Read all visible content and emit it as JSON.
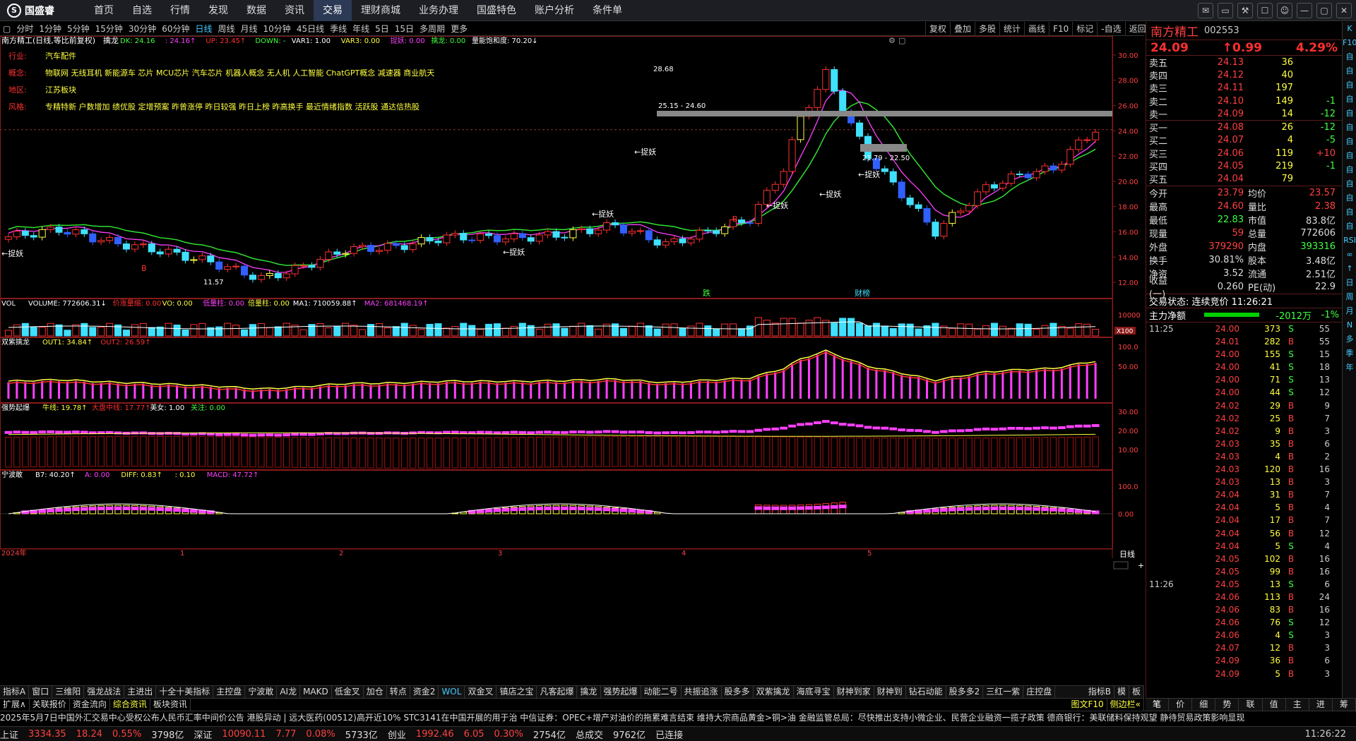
{
  "app": {
    "logo": "国盛睿",
    "logo_icon": "logo-icon"
  },
  "menu": [
    "首页",
    "自选",
    "行情",
    "发现",
    "数据",
    "资讯",
    "交易",
    "理财商城",
    "业务办理",
    "国盛特色",
    "账户分析",
    "条件单"
  ],
  "menu_active": 6,
  "periods": [
    "分时",
    "1分钟",
    "5分钟",
    "15分钟",
    "30分钟",
    "60分钟",
    "日线",
    "周线",
    "月线",
    "10分钟",
    "45日线",
    "季线",
    "年线",
    "5日",
    "15日",
    "多周期",
    "更多"
  ],
  "period_active": 6,
  "tools": [
    "复权",
    "叠加",
    "多股",
    "统计",
    "画线",
    "F10",
    "标记",
    "-自选",
    "返回"
  ],
  "stock": {
    "name": "南方精工",
    "code": "002553",
    "price": "24.09",
    "change": "↑0.99",
    "pct": "4.29%"
  },
  "main_header": {
    "title": "南方精工(日线,等比前复权)",
    "indicator": "擒龙",
    "items": [
      {
        "t": "DK: 24.16",
        "c": "#40ff40"
      },
      {
        "t": ": 24.16↑",
        "c": "#ff40ff"
      },
      {
        "t": "UP: 23.45↑",
        "c": "#ff3030"
      },
      {
        "t": "DOWN: -",
        "c": "#40ff40"
      },
      {
        "t": "VAR1: 1.00",
        "c": "#fff"
      },
      {
        "t": "VAR3: 0.00",
        "c": "#ffff40"
      },
      {
        "t": "捉妖: 0.00",
        "c": "#ff40ff"
      },
      {
        "t": "擒龙: 0.00",
        "c": "#40ff40"
      },
      {
        "t": "量能饱和度: 70.20↓",
        "c": "#fff"
      }
    ]
  },
  "stock_info": [
    {
      "k": "行业:",
      "v": "汽车配件"
    },
    {
      "k": "概念:",
      "v": "物联网 无线耳机 新能源车 芯片 MCU芯片 汽车芯片 机器人概念 无人机 人工智能 ChatGPT概念 减速器 商业航天"
    },
    {
      "k": "地区:",
      "v": "江苏板块"
    },
    {
      "k": "风格:",
      "v": "专精特新 户数增加 绩优股 定增预案 昨曾涨停 昨日较强 昨日上榜 昨高换手 最近情绪指数 活跃股 通达信热股"
    }
  ],
  "price_axis": [
    "30.00",
    "28.00",
    "26.00",
    "24.00",
    "22.00",
    "20.00",
    "18.00",
    "16.00",
    "14.00",
    "12.00"
  ],
  "annotations": {
    "high": "28.68",
    "zone1": "25.15 - 24.60",
    "zone2": "21.79 - 22.50",
    "low": "11.57",
    "label": "捉妖",
    "b_mark": "B",
    "die": "跌",
    "caibao": "财榜"
  },
  "vol_header": {
    "name": "VOL",
    "items": [
      {
        "t": "VOLUME: 772606.31↓",
        "c": "#fff"
      },
      {
        "t": "价涨量缩: 0.00",
        "c": "#ff3030"
      },
      {
        "t": "VO: 0.00",
        "c": "#ffff40"
      },
      {
        "t": "低量柱: 0.00",
        "c": "#ff40ff"
      },
      {
        "t": "倍量柱: 0.00",
        "c": "#ffff40"
      },
      {
        "t": "MA1: 710059.88↑",
        "c": "#fff"
      },
      {
        "t": "MA2: 681468.19↑",
        "c": "#ff40ff"
      }
    ],
    "axis": [
      "10000"
    ],
    "unit": "X100"
  },
  "sub1_header": {
    "name": "双紫擒龙",
    "items": [
      {
        "t": "OUT1: 34.84↑",
        "c": "#ffff40"
      },
      {
        "t": "OUT2: 26.59↑",
        "c": "#ff3030"
      }
    ],
    "axis": [
      "100.0",
      "50.00"
    ]
  },
  "sub2_header": {
    "name": "强势起爆",
    "items": [
      {
        "t": "牛线: 19.78↑",
        "c": "#ffff40"
      },
      {
        "t": "大盘中线: 17.77↑",
        "c": "#ff3030"
      },
      {
        "t": "美女: 1.00",
        "c": "#fff"
      },
      {
        "t": "关注: 0.00",
        "c": "#40ff40"
      }
    ],
    "axis": [
      "30.00",
      "20.00",
      "10.00"
    ]
  },
  "sub3_header": {
    "name": "宁波敢",
    "items": [
      {
        "t": "B7: 40.20↑",
        "c": "#fff"
      },
      {
        "t": "A: 0.00",
        "c": "#ff40ff"
      },
      {
        "t": "DIFF: 0.83↑",
        "c": "#ffff40"
      },
      {
        "t": ": 0.10",
        "c": "#ffff40"
      },
      {
        "t": "MACD: 47.72↑",
        "c": "#ff40ff"
      }
    ],
    "axis": [
      "100.0",
      "0.00"
    ]
  },
  "date_axis": [
    "2024年",
    "1",
    "2",
    "3",
    "4",
    "5"
  ],
  "period_label": "日线",
  "asks": [
    {
      "l": "卖五",
      "p": "24.13",
      "v": "36",
      "d": ""
    },
    {
      "l": "卖四",
      "p": "24.12",
      "v": "40",
      "d": ""
    },
    {
      "l": "卖三",
      "p": "24.11",
      "v": "197",
      "d": ""
    },
    {
      "l": "卖二",
      "p": "24.10",
      "v": "149",
      "d": "-1"
    },
    {
      "l": "卖一",
      "p": "24.09",
      "v": "14",
      "d": "-12"
    }
  ],
  "bids": [
    {
      "l": "买一",
      "p": "24.08",
      "v": "26",
      "d": "-12"
    },
    {
      "l": "买二",
      "p": "24.07",
      "v": "4",
      "d": "-5"
    },
    {
      "l": "买三",
      "p": "24.06",
      "v": "119",
      "d": "+10"
    },
    {
      "l": "买四",
      "p": "24.05",
      "v": "219",
      "d": "-1"
    },
    {
      "l": "买五",
      "p": "24.04",
      "v": "79",
      "d": ""
    }
  ],
  "quote": [
    {
      "a": "今开",
      "b": "23.79",
      "c": "均价",
      "e": "23.57",
      "bc": "#ff4040",
      "ec": "#ff4040"
    },
    {
      "a": "最高",
      "b": "24.60",
      "c": "量比",
      "e": "2.38",
      "bc": "#ff4040",
      "ec": "#ff4040"
    },
    {
      "a": "最低",
      "b": "22.83",
      "c": "市值",
      "e": "83.8亿",
      "bc": "#40ff40",
      "ec": "#ddd"
    },
    {
      "a": "现量",
      "b": "59",
      "c": "总量",
      "e": "772606",
      "bc": "#ff4040",
      "ec": "#ddd"
    },
    {
      "a": "外盘",
      "b": "379290",
      "c": "内盘",
      "e": "393316",
      "bc": "#ff4040",
      "ec": "#40ff40"
    },
    {
      "a": "换手",
      "b": "30.81%",
      "c": "股本",
      "e": "3.48亿",
      "bc": "#ddd",
      "ec": "#ddd"
    },
    {
      "a": "净资",
      "b": "3.52",
      "c": "流通",
      "e": "2.51亿",
      "bc": "#ddd",
      "ec": "#ddd"
    },
    {
      "a": "收益(一)",
      "b": "0.260",
      "c": "PE(动)",
      "e": "22.9",
      "bc": "#ddd",
      "ec": "#ddd"
    }
  ],
  "trade_status": "交易状态: 连续竞价 11:26:21",
  "main_net": {
    "label": "主力净额",
    "value": "-2012万",
    "pct": "-1%"
  },
  "ticks": [
    {
      "t": "11:25",
      "p": "24.00",
      "v": "373",
      "s": "S",
      "n": "55"
    },
    {
      "t": "",
      "p": "24.01",
      "v": "282",
      "s": "B",
      "n": "55"
    },
    {
      "t": "",
      "p": "24.00",
      "v": "155",
      "s": "S",
      "n": "15"
    },
    {
      "t": "",
      "p": "24.00",
      "v": "41",
      "s": "S",
      "n": "18"
    },
    {
      "t": "",
      "p": "24.00",
      "v": "71",
      "s": "S",
      "n": "13"
    },
    {
      "t": "",
      "p": "24.00",
      "v": "44",
      "s": "S",
      "n": "12"
    },
    {
      "t": "",
      "p": "24.02",
      "v": "29",
      "s": "B",
      "n": "9"
    },
    {
      "t": "",
      "p": "24.02",
      "v": "25",
      "s": "B",
      "n": "7"
    },
    {
      "t": "",
      "p": "24.02",
      "v": "9",
      "s": "B",
      "n": "3"
    },
    {
      "t": "",
      "p": "24.03",
      "v": "35",
      "s": "B",
      "n": "6"
    },
    {
      "t": "",
      "p": "24.03",
      "v": "4",
      "s": "B",
      "n": "2"
    },
    {
      "t": "",
      "p": "24.03",
      "v": "120",
      "s": "B",
      "n": "16"
    },
    {
      "t": "",
      "p": "24.03",
      "v": "13",
      "s": "B",
      "n": "3"
    },
    {
      "t": "",
      "p": "24.04",
      "v": "31",
      "s": "B",
      "n": "7"
    },
    {
      "t": "",
      "p": "24.04",
      "v": "5",
      "s": "B",
      "n": "4"
    },
    {
      "t": "",
      "p": "24.04",
      "v": "17",
      "s": "B",
      "n": "7"
    },
    {
      "t": "",
      "p": "24.04",
      "v": "56",
      "s": "B",
      "n": "12"
    },
    {
      "t": "",
      "p": "24.04",
      "v": "5",
      "s": "S",
      "n": "4"
    },
    {
      "t": "",
      "p": "24.05",
      "v": "102",
      "s": "B",
      "n": "16"
    },
    {
      "t": "",
      "p": "24.05",
      "v": "99",
      "s": "B",
      "n": "16"
    },
    {
      "t": "11:26",
      "p": "24.05",
      "v": "13",
      "s": "S",
      "n": "6"
    },
    {
      "t": "",
      "p": "24.06",
      "v": "113",
      "s": "B",
      "n": "24"
    },
    {
      "t": "",
      "p": "24.06",
      "v": "83",
      "s": "B",
      "n": "16"
    },
    {
      "t": "",
      "p": "24.06",
      "v": "76",
      "s": "S",
      "n": "12"
    },
    {
      "t": "",
      "p": "24.06",
      "v": "4",
      "s": "S",
      "n": "3"
    },
    {
      "t": "",
      "p": "24.07",
      "v": "12",
      "s": "B",
      "n": "3"
    },
    {
      "t": "",
      "p": "24.09",
      "v": "36",
      "s": "B",
      "n": "6"
    },
    {
      "t": "",
      "p": "24.09",
      "v": "5",
      "s": "B",
      "n": "3"
    }
  ],
  "side_icons": [
    "K",
    "F10",
    "自",
    "自",
    "自",
    "自",
    "自",
    "自",
    "自",
    "自",
    "自",
    "自",
    "自",
    "自",
    "自",
    "RSI",
    "∞",
    "↑",
    "日",
    "周",
    "月",
    "N",
    "多",
    "季",
    "年"
  ],
  "ind_tabs": [
    "指标A",
    "窗口",
    "三维阳",
    "强龙战法",
    "主进出",
    "十全十美指标",
    "主控盘",
    "宁波敢",
    "AI龙",
    "MAKD",
    "低金叉",
    "加仓",
    "转点",
    "资金2",
    "WOL",
    "双金叉",
    "镇店之宝",
    "凡客起爆",
    "擒龙",
    "强势起爆",
    "动能二号",
    "共振追涨",
    "股多多",
    "双紫擒龙",
    "海底寻宝",
    "财神到家",
    "财神到",
    "钻石动能",
    "股多多2",
    "三红一紫",
    "庄控盘"
  ],
  "ind_tab_active": 14,
  "ind_right": [
    "指标B",
    "模",
    "板"
  ],
  "ext_tabs": [
    "扩展∧",
    "关联报价",
    "资金流向",
    "综合资讯",
    "板块资讯"
  ],
  "ext_right": [
    "图文F10",
    "侧边栏«"
  ],
  "rb_tabs": [
    "笔",
    "价",
    "细",
    "势",
    "联",
    "值",
    "主",
    "进",
    "筹"
  ],
  "news": "2025年5月7日中国外汇交易中心受权公布人民币汇率中间价公告      港股异动 | 远大医药(00512)高开近10% STC3141在中国开展的用于治      中信证券：OPEC+增产对油价的拖累难言结束  维持大宗商品黄金>铜>油      金融监管总局：尽快推出支持小微企业、民营企业融资一揽子政策      德商银行：美联储料保持观望  静待贸易政策影响显现",
  "status": [
    {
      "t": "上证",
      "c": "#ddd"
    },
    {
      "t": "3334.35",
      "c": "#ff4040"
    },
    {
      "t": "18.24",
      "c": "#ff4040"
    },
    {
      "t": "0.55%",
      "c": "#ff4040"
    },
    {
      "t": "3798亿",
      "c": "#ddd"
    },
    {
      "t": "深证",
      "c": "#ddd"
    },
    {
      "t": "10090.11",
      "c": "#ff4040"
    },
    {
      "t": "7.77",
      "c": "#ff4040"
    },
    {
      "t": "0.08%",
      "c": "#ff4040"
    },
    {
      "t": "5733亿",
      "c": "#ddd"
    },
    {
      "t": "创业",
      "c": "#ddd"
    },
    {
      "t": "1992.46",
      "c": "#ff4040"
    },
    {
      "t": "6.05",
      "c": "#ff4040"
    },
    {
      "t": "0.30%",
      "c": "#ff4040"
    },
    {
      "t": "2754亿",
      "c": "#ddd"
    },
    {
      "t": "总成交",
      "c": "#ddd"
    },
    {
      "t": "9762亿",
      "c": "#ddd"
    },
    {
      "t": "已连接",
      "c": "#ddd"
    }
  ],
  "clock": "11:26:22",
  "colors": {
    "up": "#ff3030",
    "down": "#40ff40",
    "yellow": "#ffff40",
    "magenta": "#ff40ff",
    "cyan": "#40e0ff",
    "blue": "#3060ff"
  }
}
